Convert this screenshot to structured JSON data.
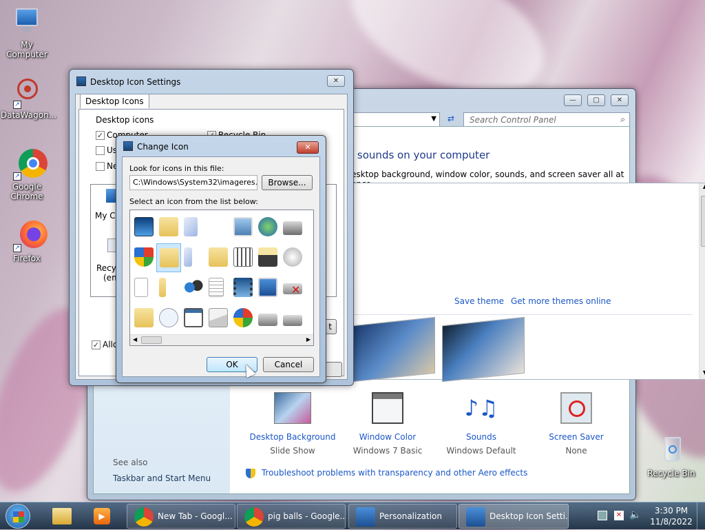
{
  "desktop": {
    "icons": [
      {
        "label": "My Computer"
      },
      {
        "label": "DataWagon..."
      },
      {
        "label": "Google Chrome"
      },
      {
        "label": "Firefox"
      },
      {
        "label": "Recycle Bin"
      }
    ]
  },
  "control_panel": {
    "search_placeholder": "Search Control Panel",
    "heading": "l sounds on your computer",
    "subheading": "esktop background, window color, sounds, and screen saver all at once.",
    "save_theme": "Save theme",
    "get_more_themes": "Get more themes online",
    "see_also_label": "See also",
    "see_also_link": "Taskbar and Start Menu",
    "bottom_items": [
      {
        "title": "Desktop Background",
        "sub": "Slide Show"
      },
      {
        "title": "Window Color",
        "sub": "Windows 7 Basic"
      },
      {
        "title": "Sounds",
        "sub": "Windows Default"
      },
      {
        "title": "Screen Saver",
        "sub": "None"
      }
    ],
    "troubleshoot": "Troubleshoot problems with transparency and other Aero effects"
  },
  "desktop_icon_settings": {
    "title": "Desktop Icon Settings",
    "tab": "Desktop Icons",
    "group_label": "Desktop icons",
    "checkboxes": [
      {
        "label": "Computer",
        "checked": true
      },
      {
        "label": "Recycle Bin",
        "checked": true
      },
      {
        "label": "Us",
        "checked": false
      },
      {
        "label": "Ne",
        "checked": false
      }
    ],
    "preview_labels": [
      "My Co",
      "Recyc",
      "(em"
    ],
    "allow_label": "Allow",
    "partial_button": "t"
  },
  "change_icon": {
    "title": "Change Icon",
    "look_label": "Look for icons in this file:",
    "file_path": "C:\\Windows\\System32\\imageres.dll",
    "browse_label": "Browse...",
    "select_label": "Select an icon from the list below:",
    "ok_label": "OK",
    "cancel_label": "Cancel"
  },
  "taskbar": {
    "buttons": [
      {
        "label": "New Tab - Googl..."
      },
      {
        "label": "pig balls - Google..."
      },
      {
        "label": "Personalization"
      },
      {
        "label": "Desktop Icon Setti..."
      }
    ],
    "time": "3:30 PM",
    "date": "11/8/2022"
  },
  "colors": {
    "accent_link": "#1a57c8",
    "selection": "#cce8ff"
  }
}
